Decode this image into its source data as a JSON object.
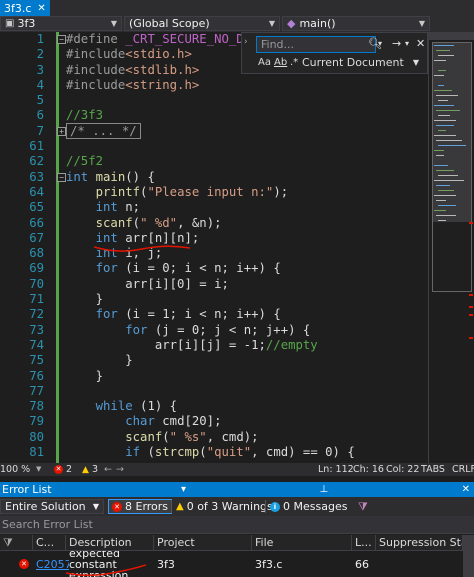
{
  "tab": {
    "title": "3f3.c"
  },
  "navbar": {
    "file": "3f3",
    "scope": "(Global Scope)",
    "function": "main()"
  },
  "code": {
    "lines": [
      {
        "n": "1",
        "html": "<span class='pp'>#define</span> <span class='mac'>_CRT_SECURE_NO_DEP</span>"
      },
      {
        "n": "2",
        "html": "<span class='pp'>#include</span><span class='str'>&lt;stdio.h&gt;</span>"
      },
      {
        "n": "3",
        "html": "<span class='pp'>#include</span><span class='str'>&lt;stdlib.h&gt;</span>"
      },
      {
        "n": "4",
        "html": "<span class='pp'>#include</span><span class='str'>&lt;string.h&gt;</span>"
      },
      {
        "n": "5",
        "html": ""
      },
      {
        "n": "6",
        "html": "<span class='cm'>//3f3</span>"
      },
      {
        "n": "7",
        "html": "<span class='collapsed-region'>/* ... */</span>"
      },
      {
        "n": "61",
        "html": ""
      },
      {
        "n": "62",
        "html": "<span class='cm'>//5f2</span>"
      },
      {
        "n": "63",
        "html": "<span class='kw'>int</span> <span class='fn'>main</span>() {"
      },
      {
        "n": "64",
        "html": "    <span class='fn'>printf</span>(<span class='str'>\"Please input n:\"</span>);"
      },
      {
        "n": "65",
        "html": "    <span class='kw'>int</span> n;"
      },
      {
        "n": "66",
        "html": "    <span class='fn'>scanf</span>(<span class='str'>\" %d\"</span>, &amp;n);"
      },
      {
        "n": "67",
        "html": "    <span class='kw'>int</span> arr[n][n];"
      },
      {
        "n": "68",
        "html": "    <span class='kw'>int</span> i, j;"
      },
      {
        "n": "69",
        "html": "    <span class='kw'>for</span> (i = 0; i &lt; n; i++) {"
      },
      {
        "n": "70",
        "html": "        arr[i][0] = i;"
      },
      {
        "n": "71",
        "html": "    }"
      },
      {
        "n": "72",
        "html": "    <span class='kw'>for</span> (i = 1; i &lt; n; i++) {"
      },
      {
        "n": "73",
        "html": "        <span class='kw'>for</span> (j = 0; j &lt; n; j++) {"
      },
      {
        "n": "74",
        "html": "            arr[i][j] = -1;<span class='cm'>//empty</span>"
      },
      {
        "n": "75",
        "html": "        }"
      },
      {
        "n": "76",
        "html": "    }"
      },
      {
        "n": "77",
        "html": ""
      },
      {
        "n": "78",
        "html": "    <span class='kw'>while</span> (1) {"
      },
      {
        "n": "79",
        "html": "        <span class='kw'>char</span> cmd[20];"
      },
      {
        "n": "80",
        "html": "        <span class='fn'>scanf</span>(<span class='str'>\" %s\"</span>, cmd);"
      },
      {
        "n": "81",
        "html": "        <span class='kw'>if</span> (<span class='fn'>strcmp</span>(<span class='str'>\"quit\"</span>, cmd) == 0) {"
      }
    ]
  },
  "find": {
    "placeholder": "Find...",
    "match_case": "Aa",
    "whole_word": "Ab",
    "regex": ".*",
    "scope": "Current Document"
  },
  "status": {
    "zoom": "100 %",
    "errors": "2",
    "warnings": "3",
    "line": "Ln: 112",
    "col": "Ch: 16",
    "colnum": "Col: 22",
    "tabs": "TABS",
    "eol": "CRLF"
  },
  "error_list": {
    "title": "Error List",
    "scope": "Entire Solution",
    "errors_btn": "8 Errors",
    "warnings_btn": "0 of 3 Warnings",
    "messages_btn": "0 Messages",
    "search_placeholder": "Search Error List",
    "columns": [
      "C...",
      "Description",
      "Project",
      "File",
      "L...",
      "Suppression Sta"
    ],
    "rows": [
      {
        "code": "C2057",
        "description": "expected constant expression",
        "project": "3f3",
        "file": "3f3.c",
        "line": "66"
      }
    ]
  },
  "colors": {
    "accent": "#007acc",
    "error": "#e51400",
    "warning": "#ffcc00"
  }
}
